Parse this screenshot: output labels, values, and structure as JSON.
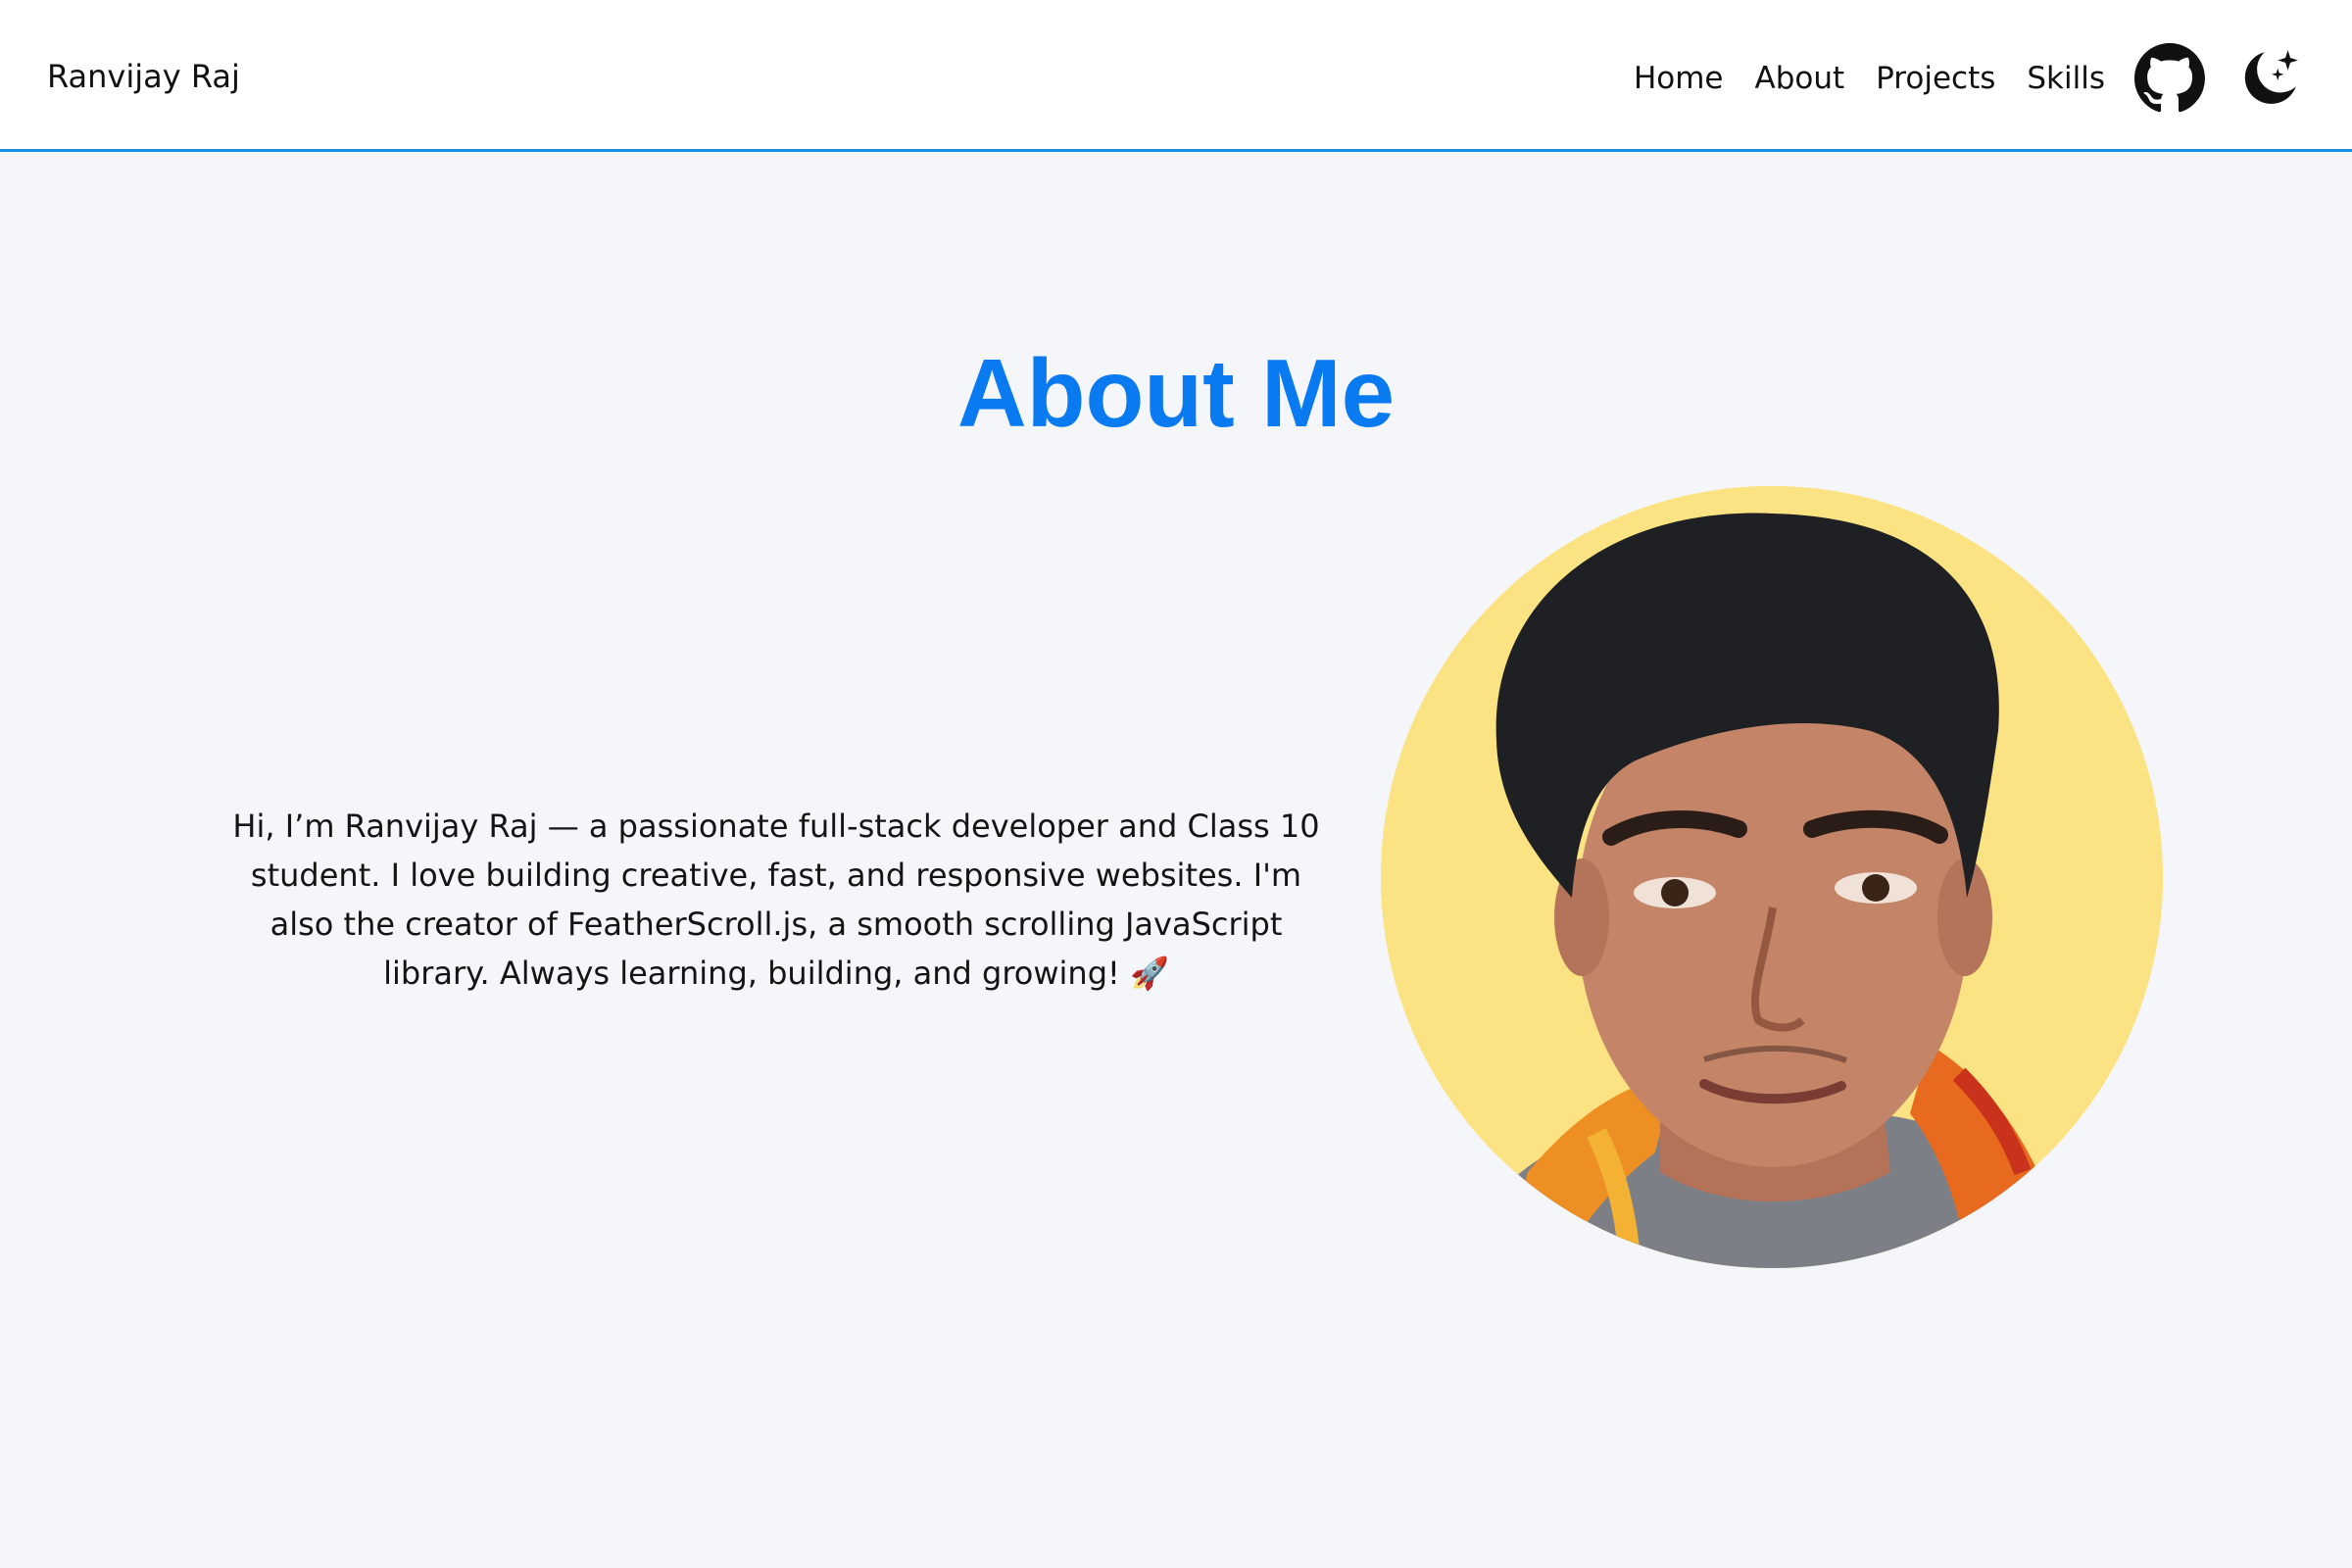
{
  "brand": "Ranvijay Raj",
  "nav": {
    "links": [
      "Home",
      "About",
      "Projects",
      "Skills"
    ],
    "github_icon": "github-icon",
    "theme_icon": "moon-stars-icon"
  },
  "about": {
    "title": "About Me",
    "text": "Hi, I’m Ranvijay Raj — a passionate full-stack developer and Class 10 student. I love building creative, fast, and responsive websites. I'm also the creator of FeatherScroll.js, a smooth scrolling JavaScript library. Always learning, building, and growing! 🚀",
    "photo_alt": "Ranvijay Raj"
  },
  "colors": {
    "accent": "#0a7af0",
    "navbar_border": "#1a8fe0",
    "page_background": "#f5f6f9",
    "photo_background": "#fbe283"
  }
}
